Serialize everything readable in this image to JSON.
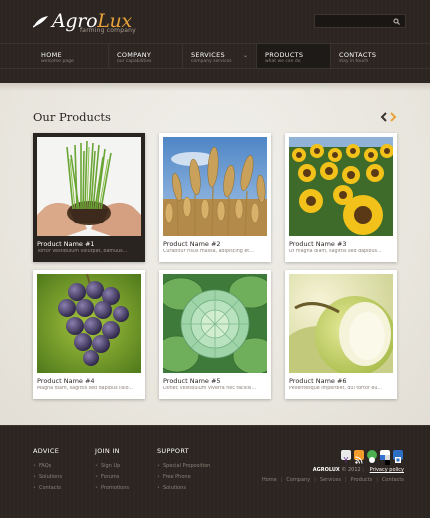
{
  "header": {
    "logo_part1": "Agro",
    "logo_part2": "Lux",
    "tagline": "farming company",
    "search_placeholder": ""
  },
  "nav": [
    {
      "label": "HOME",
      "sub": "welcome page"
    },
    {
      "label": "COMPANY",
      "sub": "our capabilities"
    },
    {
      "label": "SERVICES",
      "sub": "company services"
    },
    {
      "label": "PRODUCTS",
      "sub": "what we can do"
    },
    {
      "label": "CONTACTS",
      "sub": "stay in touch"
    }
  ],
  "main": {
    "title": "Our Products",
    "products": [
      {
        "name": "Product Name #1",
        "desc": "Tortor vestibulum volutpat, bamuus..."
      },
      {
        "name": "Product Name #2",
        "desc": "Curabitur risus massa, adipiscing et..."
      },
      {
        "name": "Product Name #3",
        "desc": "Ut magna diam, sagittis sed dapibus..."
      },
      {
        "name": "Product Name #4",
        "desc": "Magna diam, sagittis sed dapibus lisio..."
      },
      {
        "name": "Product Name #5",
        "desc": "Donec vestibulum viverra nec facilisi..."
      },
      {
        "name": "Product Name #6",
        "desc": "Pellentesque imperdiet, dui tortor eu..."
      }
    ]
  },
  "footer": {
    "advice": {
      "title": "ADVICE",
      "links": [
        "FAQs",
        "Solutions",
        "Contacts"
      ]
    },
    "join": {
      "title": "JOIN IN",
      "links": [
        "Sign Up",
        "Forums",
        "Promotions"
      ]
    },
    "support": {
      "title": "SUPPORT",
      "links": [
        "Special Proposition",
        "Free Phone",
        "Solutions"
      ]
    },
    "brand": "AGROLUX",
    "copyright": "© 2012",
    "privacy": "Privacy policy",
    "nav": [
      "Home",
      "Company",
      "Services",
      "Products",
      "Contacts"
    ],
    "social_icons": [
      "yahoo-icon",
      "rss-icon",
      "messenger-icon",
      "delicious-icon",
      "share-icon"
    ]
  },
  "colors": {
    "header_bg": "#2a2421",
    "accent_orange": "#e8a23a",
    "main_bg": "#ebe8e0"
  }
}
